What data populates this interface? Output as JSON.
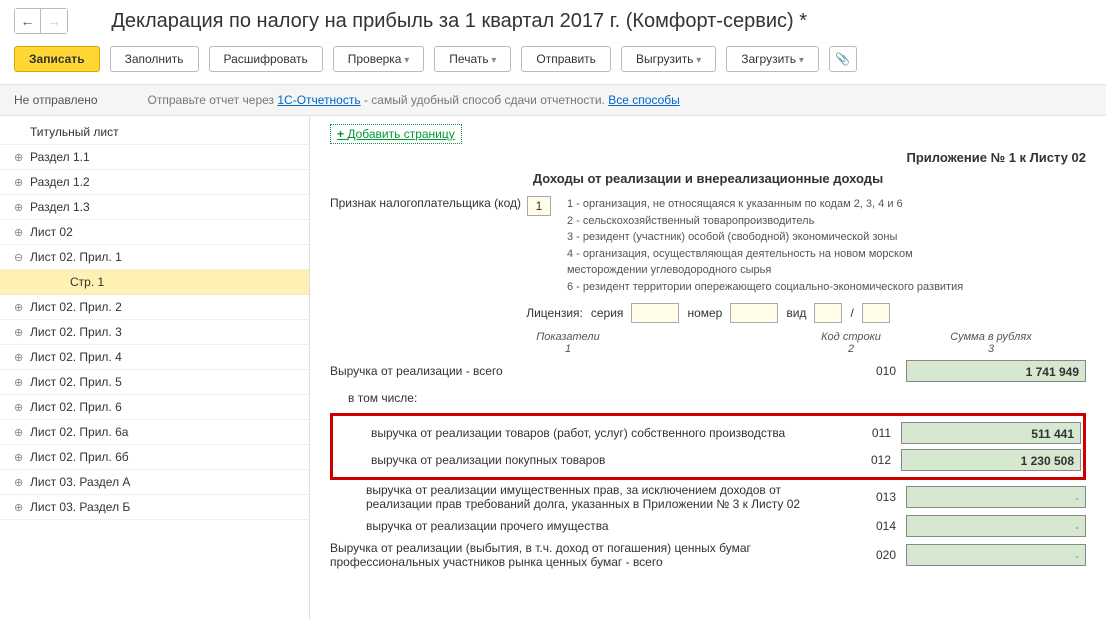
{
  "title": "Декларация по налогу на прибыль за 1 квартал 2017 г. (Комфорт-сервис) *",
  "toolbar": {
    "save": "Записать",
    "fill": "Заполнить",
    "decode": "Расшифровать",
    "check": "Проверка",
    "print": "Печать",
    "send": "Отправить",
    "upload": "Выгрузить",
    "download": "Загрузить"
  },
  "status": {
    "label": "Не отправлено",
    "msg_prefix": "Отправьте отчет через ",
    "link1": "1С-Отчетность",
    "msg_suffix": " - самый удобный способ сдачи отчетности. ",
    "link2": "Все способы"
  },
  "tree": [
    {
      "l": "Титульный лист",
      "lvl": 0,
      "exp": ""
    },
    {
      "l": "Раздел 1.1",
      "lvl": 0,
      "exp": "⊕"
    },
    {
      "l": "Раздел 1.2",
      "lvl": 0,
      "exp": "⊕"
    },
    {
      "l": "Раздел 1.3",
      "lvl": 0,
      "exp": "⊕"
    },
    {
      "l": "Лист 02",
      "lvl": 0,
      "exp": "⊕"
    },
    {
      "l": "Лист 02. Прил. 1",
      "lvl": 0,
      "exp": "⊖"
    },
    {
      "l": "Стр. 1",
      "lvl": 2,
      "exp": "",
      "sel": true
    },
    {
      "l": "Лист 02. Прил. 2",
      "lvl": 0,
      "exp": "⊕"
    },
    {
      "l": "Лист 02. Прил. 3",
      "lvl": 0,
      "exp": "⊕"
    },
    {
      "l": "Лист 02. Прил. 4",
      "lvl": 0,
      "exp": "⊕"
    },
    {
      "l": "Лист 02. Прил. 5",
      "lvl": 0,
      "exp": "⊕"
    },
    {
      "l": "Лист 02. Прил. 6",
      "lvl": 0,
      "exp": "⊕"
    },
    {
      "l": "Лист 02. Прил. 6а",
      "lvl": 0,
      "exp": "⊕"
    },
    {
      "l": "Лист 02. Прил. 6б",
      "lvl": 0,
      "exp": "⊕"
    },
    {
      "l": "Лист 03. Раздел А",
      "lvl": 0,
      "exp": "⊕"
    },
    {
      "l": "Лист 03. Раздел Б",
      "lvl": 0,
      "exp": "⊕"
    }
  ],
  "main": {
    "add_page": "Добавить страницу",
    "appendix": "Приложение № 1 к Листу 02",
    "section": "Доходы от реализации и внереализационные доходы",
    "taxpayer_label": "Признак налогоплательщика (код)",
    "taxpayer_code": "1",
    "hints": [
      "1 - организация, не относящаяся к указанным по кодам 2, 3, 4 и 6",
      "2 - сельскохозяйственный товаропроизводитель",
      "3 - резидент (участник) особой (свободной) экономической зоны",
      "4 - организация, осуществляющая деятельность на новом морском",
      "месторождении углеводородного сырья",
      "6 - резидент территории опережающего социально-экономического развития"
    ],
    "license": {
      "label": "Лицензия:",
      "serie": "серия",
      "number": "номер",
      "type": "вид"
    },
    "cols": {
      "c1a": "Показатели",
      "c1b": "1",
      "c2a": "Код строки",
      "c2b": "2",
      "c3a": "Сумма в рублях",
      "c3b": "3"
    },
    "rows": [
      {
        "desc": "Выручка от реализации - всего",
        "code": "010",
        "val": "1 741 949",
        "ind": 0
      },
      {
        "desc": "в том числе:",
        "code": "",
        "val": null,
        "ind": 1
      },
      {
        "desc": "выручка от реализации товаров (работ, услуг) собственного производства",
        "code": "011",
        "val": "511 441",
        "ind": 2,
        "hl": true
      },
      {
        "desc": "выручка от реализации покупных товаров",
        "code": "012",
        "val": "1 230 508",
        "ind": 2,
        "hl": true
      },
      {
        "desc": "выручка от реализации имущественных прав, за исключением доходов от реализации прав требований долга, указанных в Приложении № 3 к Листу 02",
        "code": "013",
        "val": "-",
        "ind": 2
      },
      {
        "desc": "выручка от реализации прочего имущества",
        "code": "014",
        "val": "-",
        "ind": 2
      },
      {
        "desc": "Выручка от реализации (выбытия, в т.ч. доход от погашения) ценных бумаг профессиональных участников рынка ценных бумаг - всего",
        "code": "020",
        "val": "-",
        "ind": 0
      }
    ]
  }
}
